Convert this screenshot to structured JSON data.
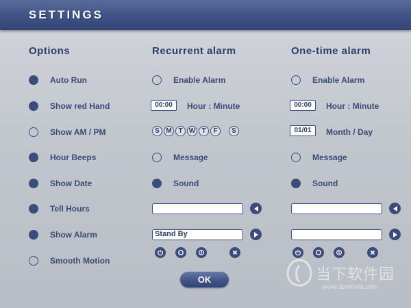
{
  "window": {
    "title": "SETTINGS"
  },
  "options": {
    "heading": "Options",
    "items": [
      {
        "label": "Auto Run",
        "checked": true
      },
      {
        "label": "Show red Hand",
        "checked": true
      },
      {
        "label": "Show AM / PM",
        "checked": false
      },
      {
        "label": "Hour Beeps",
        "checked": true
      },
      {
        "label": "Show Date",
        "checked": true
      },
      {
        "label": "Tell Hours",
        "checked": true
      },
      {
        "label": "Show Alarm",
        "checked": true
      },
      {
        "label": "Smooth Motion",
        "checked": false
      }
    ]
  },
  "recurrent": {
    "heading": "Recurrent alarm",
    "enable_label": "Enable Alarm",
    "enable_checked": false,
    "time_value": "00:00",
    "time_label": "Hour : Minute",
    "days": [
      "S",
      "M",
      "T",
      "W",
      "T",
      "F",
      "S"
    ],
    "message_label": "Message",
    "message_checked": false,
    "sound_label": "Sound",
    "sound_checked": true,
    "message_field": "",
    "sound_field": "Stand By"
  },
  "onetime": {
    "heading": "One-time alarm",
    "enable_label": "Enable Alarm",
    "enable_checked": false,
    "time_value": "00:00",
    "time_label": "Hour : Minute",
    "date_value": "01/01",
    "date_label": "Month / Day",
    "message_label": "Message",
    "message_checked": false,
    "sound_label": "Sound",
    "sound_checked": true,
    "message_field": "",
    "sound_field": ""
  },
  "ok_label": "OK",
  "watermark": {
    "text": "当下软件园",
    "url": "www.downxia.com"
  },
  "colors": {
    "accent": "#3b4c7a",
    "titlebar": "#3f5286"
  }
}
